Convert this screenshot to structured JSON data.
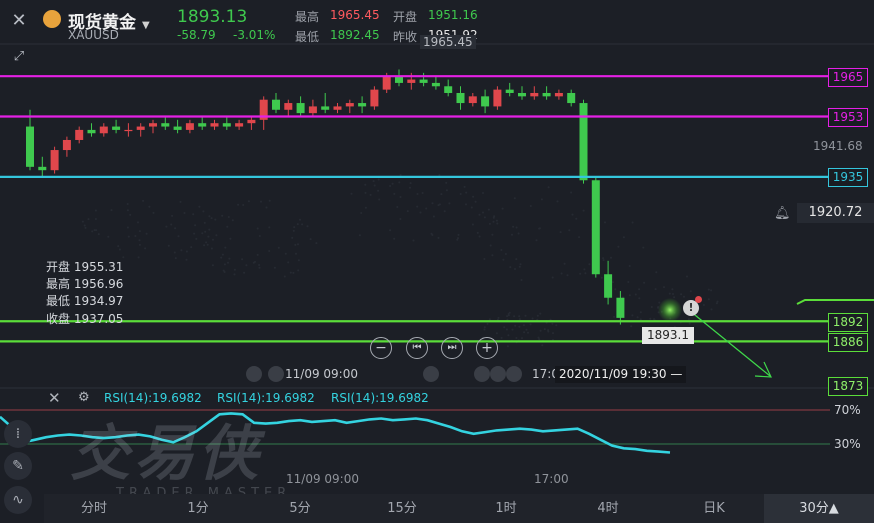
{
  "header": {
    "close_icon": "close-icon",
    "expand_icon": "expand-icon",
    "title": "现货黄金",
    "symbol": "XAUUSD",
    "price": "1893.13",
    "change": "-58.79",
    "change_pct": "-3.01%",
    "high_label": "最高",
    "high_value": "1965.45",
    "low_label": "最低",
    "low_value": "1892.45",
    "open_label": "开盘",
    "open_value": "1951.16",
    "prev_label": "昨收",
    "prev_value": "1951.92",
    "colors": {
      "up": "#e0474c",
      "down": "#3fc94e",
      "header_high": "#ff5a5f"
    }
  },
  "ohlc_box": {
    "open": "开盘 1955.31",
    "high": "最高 1956.96",
    "low": "最低 1934.97",
    "close": "收盘 1937.05"
  },
  "annotations": {
    "top_high": "1965.45",
    "mid_price": "1941.68",
    "alert_price": "1920.72",
    "last_low": "1893.1",
    "crosshair_time": "2020/11/09 19:30 —",
    "rsi_time_top": "11/09 09:00",
    "rsi_time_top2": "17:0",
    "rsi_time_bottom": "11/09 09:00",
    "rsi_time_bottom2": "17:00"
  },
  "level_lines": [
    {
      "label": "1965",
      "value": 1965,
      "color": "#e520e6"
    },
    {
      "label": "1953",
      "value": 1953,
      "color": "#e520e6"
    },
    {
      "label": "1935",
      "value": 1935,
      "color": "#34c6dc"
    },
    {
      "label": "1892",
      "value": 1892,
      "color": "#5bdd3a"
    },
    {
      "label": "1886",
      "value": 1886,
      "color": "#5bdd3a"
    },
    {
      "label": "1873",
      "value": 1873,
      "color": "#5bdd3a"
    }
  ],
  "rsi": {
    "label1": "RSI(14):19.6982",
    "label2": "RSI(14):19.6982",
    "label3": "RSI(14):19.6982",
    "level_70": "70%",
    "level_30": "30%",
    "values": [
      62,
      50,
      32,
      35,
      38,
      40,
      41,
      40,
      38,
      37,
      38,
      40,
      41,
      39,
      35,
      32,
      38,
      45,
      55,
      65,
      66,
      65,
      55,
      54,
      55,
      57,
      58,
      56,
      57,
      58,
      55,
      57,
      59,
      60,
      58,
      59,
      60,
      58,
      54,
      50,
      45,
      42,
      44,
      46,
      47,
      48,
      47,
      45,
      46,
      47,
      48,
      42,
      35,
      28,
      25,
      24,
      22,
      21,
      20
    ]
  },
  "controls": {
    "zoom_out": "−",
    "prev": "⏮",
    "next": "⏭",
    "zoom_in": "+"
  },
  "watermark": {
    "main": "交易侠",
    "sub": "TRADER MASTER"
  },
  "timeframes": [
    "分时",
    "1分",
    "5分",
    "15分",
    "1时",
    "4时",
    "日K",
    "30分▲"
  ],
  "chart_data": {
    "type": "candlestick",
    "ylim": [
      1873,
      1974
    ],
    "candles": [
      [
        1950,
        1955,
        1937,
        1938
      ],
      [
        1938,
        1941,
        1935,
        1937
      ],
      [
        1937,
        1944,
        1936,
        1943
      ],
      [
        1943,
        1947,
        1941,
        1946
      ],
      [
        1946,
        1950,
        1945,
        1949
      ],
      [
        1949,
        1951,
        1947,
        1948
      ],
      [
        1948,
        1951,
        1947,
        1950
      ],
      [
        1950,
        1952,
        1948,
        1949
      ],
      [
        1949,
        1951,
        1947,
        1949
      ],
      [
        1949,
        1951,
        1947,
        1950
      ],
      [
        1950,
        1952,
        1948,
        1951
      ],
      [
        1951,
        1953,
        1949,
        1950
      ],
      [
        1950,
        1952,
        1948,
        1949
      ],
      [
        1949,
        1952,
        1948,
        1951
      ],
      [
        1951,
        1953,
        1949,
        1950
      ],
      [
        1950,
        1952,
        1949,
        1951
      ],
      [
        1951,
        1953,
        1949,
        1950
      ],
      [
        1950,
        1952,
        1949,
        1951
      ],
      [
        1951,
        1953,
        1949,
        1952
      ],
      [
        1952,
        1959,
        1949,
        1958
      ],
      [
        1958,
        1960,
        1954,
        1955
      ],
      [
        1955,
        1958,
        1953,
        1957
      ],
      [
        1957,
        1959,
        1953,
        1954
      ],
      [
        1954,
        1958,
        1953,
        1956
      ],
      [
        1956,
        1960,
        1954,
        1955
      ],
      [
        1955,
        1957,
        1954,
        1956
      ],
      [
        1956,
        1958,
        1954,
        1957
      ],
      [
        1957,
        1959,
        1954,
        1956
      ],
      [
        1956,
        1962,
        1955,
        1961
      ],
      [
        1961,
        1966,
        1960,
        1965
      ],
      [
        1965,
        1967,
        1962,
        1963
      ],
      [
        1963,
        1966,
        1961,
        1964
      ],
      [
        1964,
        1966,
        1962,
        1963
      ],
      [
        1963,
        1965,
        1961,
        1962
      ],
      [
        1962,
        1964,
        1959,
        1960
      ],
      [
        1960,
        1962,
        1955,
        1957
      ],
      [
        1957,
        1960,
        1956,
        1959
      ],
      [
        1959,
        1961,
        1954,
        1956
      ],
      [
        1956,
        1962,
        1955,
        1961
      ],
      [
        1961,
        1963,
        1959,
        1960
      ],
      [
        1960,
        1962,
        1958,
        1959
      ],
      [
        1959,
        1962,
        1958,
        1960
      ],
      [
        1960,
        1962,
        1958,
        1959
      ],
      [
        1959,
        1961,
        1958,
        1960
      ],
      [
        1960,
        1961,
        1956,
        1957
      ],
      [
        1957,
        1958,
        1933,
        1934
      ],
      [
        1934,
        1935,
        1905,
        1906
      ],
      [
        1906,
        1910,
        1897,
        1899
      ],
      [
        1899,
        1901,
        1891,
        1893
      ]
    ],
    "crosshair_price": 1893.1
  }
}
